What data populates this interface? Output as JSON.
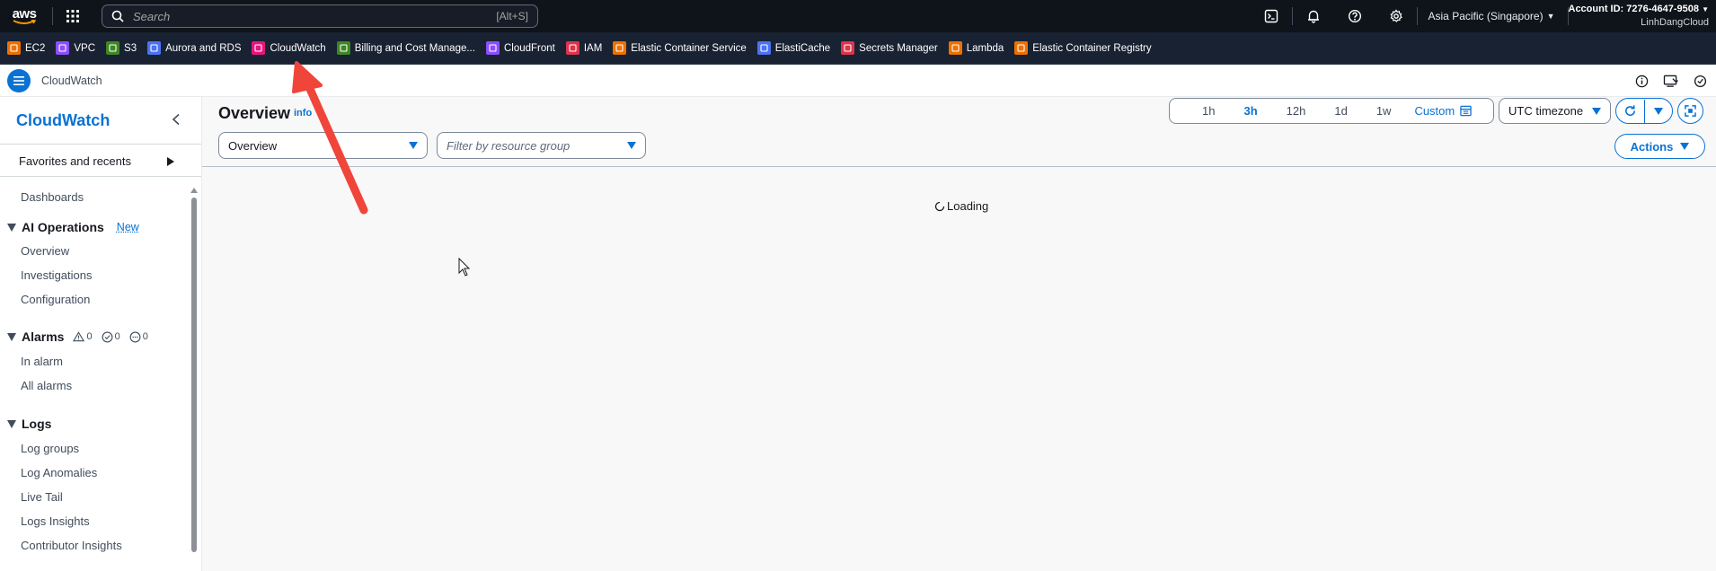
{
  "topnav": {
    "logo_text": "aws",
    "search_placeholder": "Search",
    "search_shortcut": "[Alt+S]",
    "region": "Asia Pacific (Singapore)",
    "account_id": "Account ID: 7276-4647-9508",
    "account_user": "LinhDangCloud",
    "icons": [
      "cloudshell-icon",
      "bell-icon",
      "help-icon",
      "settings-icon"
    ]
  },
  "favorites": [
    {
      "label": "EC2",
      "color": "#ed7100"
    },
    {
      "label": "VPC",
      "color": "#8c4fff"
    },
    {
      "label": "S3",
      "color": "#3f8624"
    },
    {
      "label": "Aurora and RDS",
      "color": "#4d72f3"
    },
    {
      "label": "CloudWatch",
      "color": "#e7157b"
    },
    {
      "label": "Billing and Cost Manage...",
      "color": "#3f8624"
    },
    {
      "label": "CloudFront",
      "color": "#8c4fff"
    },
    {
      "label": "IAM",
      "color": "#dd344c"
    },
    {
      "label": "Elastic Container Service",
      "color": "#ed7100"
    },
    {
      "label": "ElastiCache",
      "color": "#4d72f3"
    },
    {
      "label": "Secrets Manager",
      "color": "#dd344c"
    },
    {
      "label": "Lambda",
      "color": "#ed7100"
    },
    {
      "label": "Elastic Container Registry",
      "color": "#ed7100"
    }
  ],
  "header": {
    "service_name": "CloudWatch"
  },
  "sidebar": {
    "title": "CloudWatch",
    "favorites_label": "Favorites and recents",
    "dashboards": "Dashboards",
    "ai_ops": {
      "label": "AI Operations",
      "badge": "New",
      "items": [
        "Overview",
        "Investigations",
        "Configuration"
      ]
    },
    "alarms": {
      "label": "Alarms",
      "counts": [
        "0",
        "0",
        "0"
      ],
      "items": [
        "In alarm",
        "All alarms"
      ]
    },
    "logs": {
      "label": "Logs",
      "items": [
        "Log groups",
        "Log Anomalies",
        "Live Tail",
        "Logs Insights",
        "Contributor Insights"
      ]
    }
  },
  "main": {
    "title": "Overview",
    "info": "info",
    "overview_select": "Overview",
    "resource_group_placeholder": "Filter by resource group",
    "time_ranges": [
      "1h",
      "3h",
      "12h",
      "1d",
      "1w"
    ],
    "active_range": "3h",
    "custom_label": "Custom",
    "timezone": "UTC timezone",
    "actions_label": "Actions",
    "loading_text": "Loading"
  },
  "colors": {
    "accent": "#0972d3",
    "topnav_bg": "#0f141a",
    "favbar_bg": "#192232",
    "annotation_arrow": "#f0453a"
  }
}
